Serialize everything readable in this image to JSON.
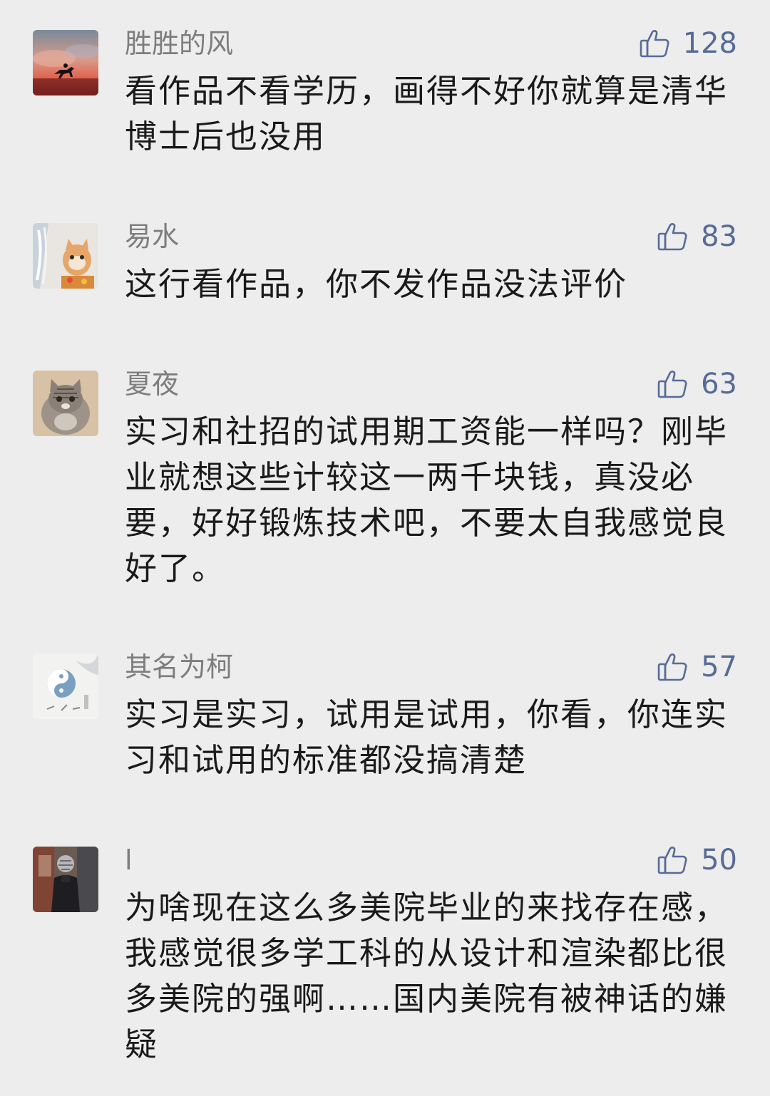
{
  "comments": [
    {
      "avatar_icon": "horse-rider-sunset-avatar",
      "username": "胜胜的风",
      "likes": "128",
      "text": "看作品不看学历，画得不好你就算是清华博士后也没用"
    },
    {
      "avatar_icon": "cat-avatar",
      "username": "易水",
      "likes": "83",
      "text": "这行看作品，你不发作品没法评价"
    },
    {
      "avatar_icon": "tabby-cat-avatar",
      "username": "夏夜",
      "likes": "63",
      "text": "实习和社招的试用期工资能一样吗？刚毕业就想这些计较这一两千块钱，真没必要，好好锻炼技术吧，不要太自我感觉良好了。"
    },
    {
      "avatar_icon": "yin-yang-ink-avatar",
      "username": "其名为柯",
      "likes": "57",
      "text": "实习是实习，试用是试用，你看，你连实习和试用的标准都没搞清楚"
    },
    {
      "avatar_icon": "helmet-person-avatar",
      "username": "l",
      "likes": "50",
      "text": "为啥现在这么多美院毕业的来找存在感，我感觉很多学工科的从设计和渲染都比很多美院的强啊……国内美院有被神话的嫌疑"
    }
  ],
  "like_icon": "thumbs-up-icon",
  "colors": {
    "background": "#ededed",
    "username": "#7d7d7d",
    "like_accent": "#576b95",
    "text": "#1a1a1a"
  }
}
